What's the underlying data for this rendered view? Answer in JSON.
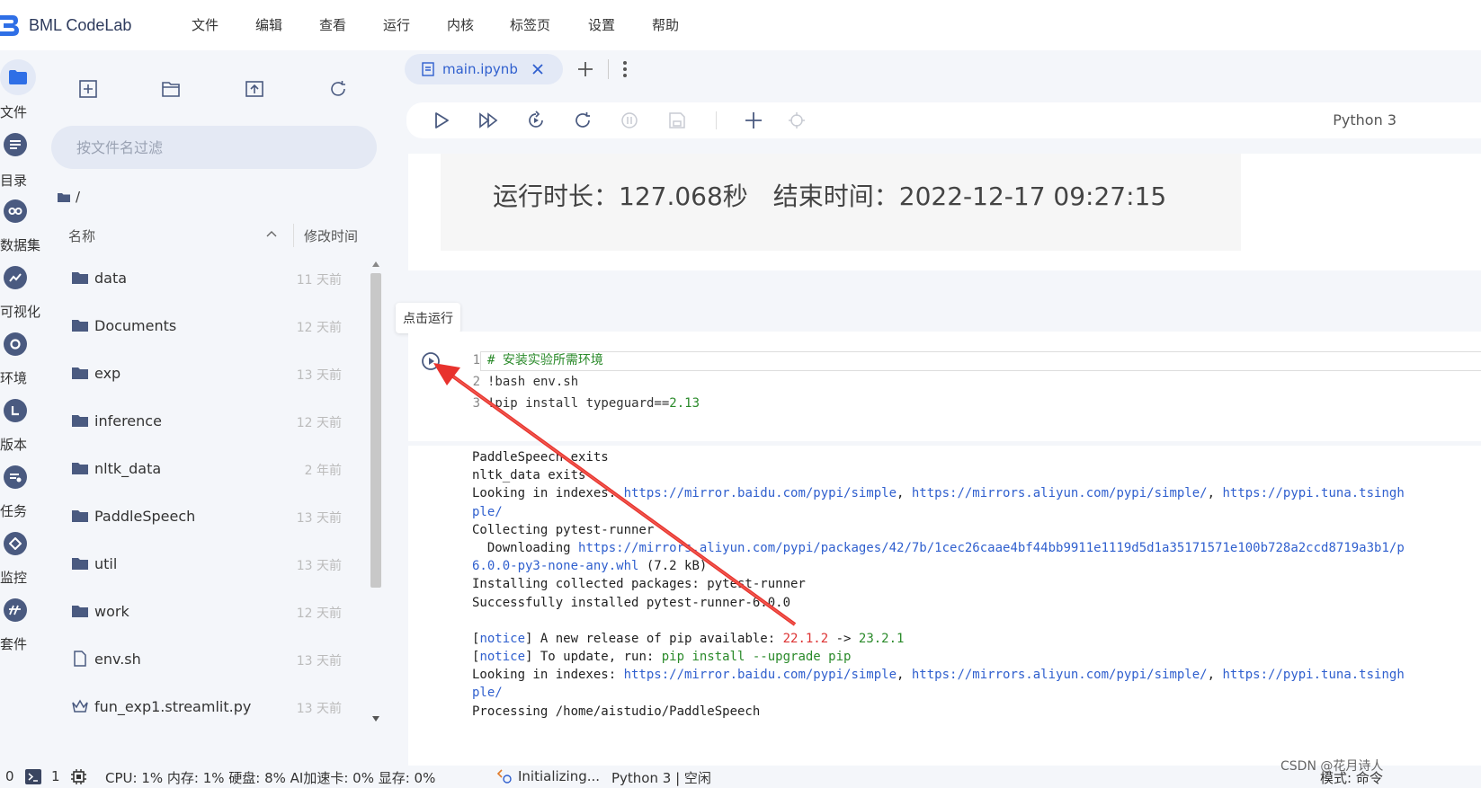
{
  "app": {
    "name": "BML CodeLab"
  },
  "menu": [
    "文件",
    "编辑",
    "查看",
    "运行",
    "内核",
    "标签页",
    "设置",
    "帮助"
  ],
  "sidebar": {
    "items": [
      {
        "label": "文件",
        "icon": "folder-icon"
      },
      {
        "label": "目录",
        "icon": "toc-icon"
      },
      {
        "label": "数据集",
        "icon": "dataset-icon"
      },
      {
        "label": "可视化",
        "icon": "chart-icon"
      },
      {
        "label": "环境",
        "icon": "environment-icon"
      },
      {
        "label": "版本",
        "icon": "version-icon"
      },
      {
        "label": "任务",
        "icon": "task-icon"
      },
      {
        "label": "监控",
        "icon": "monitor-icon"
      },
      {
        "label": "套件",
        "icon": "suite-icon"
      }
    ]
  },
  "filebrowser": {
    "filter_placeholder": "按文件名过滤",
    "path": "/",
    "col_name": "名称",
    "col_modified": "修改时间",
    "files": [
      {
        "name": "data",
        "time": "11 天前",
        "type": "folder"
      },
      {
        "name": "Documents",
        "time": "12 天前",
        "type": "folder"
      },
      {
        "name": "exp",
        "time": "13 天前",
        "type": "folder"
      },
      {
        "name": "inference",
        "time": "12 天前",
        "type": "folder"
      },
      {
        "name": "nltk_data",
        "time": "2 年前",
        "type": "folder"
      },
      {
        "name": "PaddleSpeech",
        "time": "13 天前",
        "type": "folder"
      },
      {
        "name": "util",
        "time": "13 天前",
        "type": "folder"
      },
      {
        "name": "work",
        "time": "12 天前",
        "type": "folder"
      },
      {
        "name": "env.sh",
        "time": "13 天前",
        "type": "file"
      },
      {
        "name": "fun_exp1.streamlit.py",
        "time": "13 天前",
        "type": "streamlit"
      }
    ]
  },
  "tabs": [
    {
      "label": "main.ipynb",
      "active": true
    }
  ],
  "toolbar": {
    "kernel": "Python 3"
  },
  "notebook": {
    "prev_output": "运行时长：127.068秒　结束时间：2022-12-17 09:27:15",
    "tooltip": "点击运行",
    "cell_code": [
      {
        "n": "1",
        "text": "# 安装实验所需环境"
      },
      {
        "n": "2",
        "text": "!bash env.sh"
      },
      {
        "n": "3",
        "text": "!pip install typeguard==2.13"
      }
    ],
    "output_lines": [
      "PaddleSpeech exits",
      "nltk_data exits",
      "Looking in indexes: https://mirror.baidu.com/pypi/simple, https://mirrors.aliyun.com/pypi/simple/, https://pypi.tuna.tsingh",
      "ple/",
      "Collecting pytest-runner",
      "  Downloading https://mirrors.aliyun.com/pypi/packages/42/7b/1cec26caae4bf44bb9911e1119d5d1a35171571e100b728a2ccd8719a3b1/p",
      "6.0.0-py3-none-any.whl (7.2 kB)",
      "Installing collected packages: pytest-runner",
      "Successfully installed pytest-runner-6.0.0",
      "",
      "[notice] A new release of pip available: 22.1.2 -> 23.2.1",
      "[notice] To update, run: pip install --upgrade pip",
      "Looking in indexes: https://mirror.baidu.com/pypi/simple, https://mirrors.aliyun.com/pypi/simple/, https://pypi.tuna.tsingh",
      "ple/",
      "Processing /home/aistudio/PaddleSpeech"
    ]
  },
  "statusbar": {
    "count0": "0",
    "count1": "1",
    "resources": "CPU:  1% 内存:  1% 硬盘:  8% AI加速卡:  0% 显存:  0%",
    "kernel_state": "Initializing...",
    "kernel_info": "Python 3 | 空闲",
    "mode": "模式: 命令",
    "watermark": "CSDN @花月诗人"
  }
}
